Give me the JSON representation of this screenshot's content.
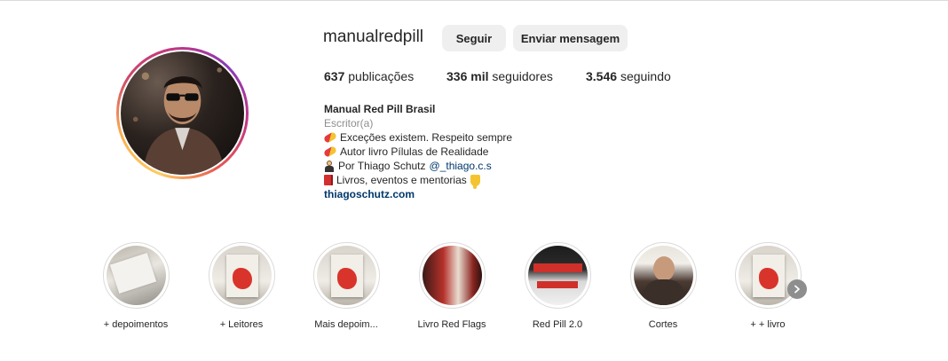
{
  "profile": {
    "username": "manualredpill",
    "follow_label": "Seguir",
    "message_label": "Enviar mensagem"
  },
  "stats": {
    "posts_count": "637",
    "posts_label": "publicações",
    "followers_count": "336 mil",
    "followers_label": "seguidores",
    "following_count": "3.546",
    "following_label": "seguindo"
  },
  "bio": {
    "name": "Manual Red Pill Brasil",
    "category": "Escritor(a)",
    "line1": "Exceções existem. Respeito sempre",
    "line2": "Autor livro Pílulas de Realidade",
    "line3": "Por Thiago Schutz",
    "mention": "@_thiago.c.s",
    "line4": "Livros, eventos e mentorias",
    "website": "thiagoschutz.com"
  },
  "highlights": [
    {
      "label": "+ depoimentos"
    },
    {
      "label": "+ Leitores"
    },
    {
      "label": "Mais depoim..."
    },
    {
      "label": "Livro Red Flags"
    },
    {
      "label": "Red Pill 2.0"
    },
    {
      "label": "Cortes"
    },
    {
      "label": "+ + livro"
    }
  ],
  "icons": {
    "pill": "pill-icon",
    "judge": "judge-icon",
    "book": "red-book-icon",
    "hand": "pointing-down-icon",
    "next": "chevron-right-icon"
  }
}
